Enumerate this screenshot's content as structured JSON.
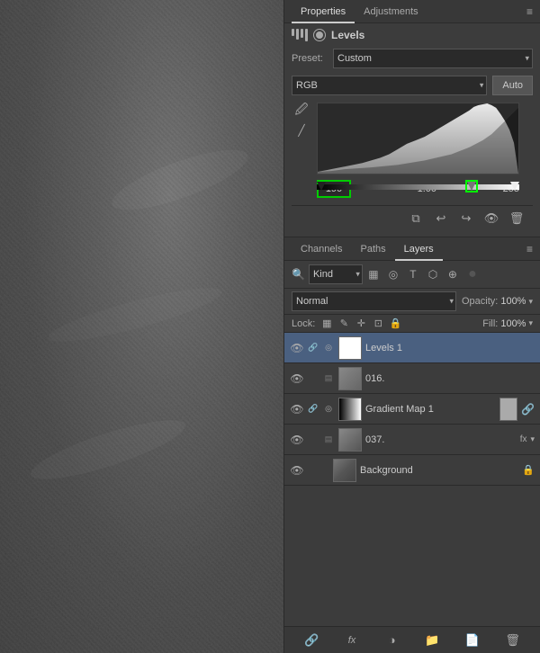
{
  "canvas": {
    "description": "Grayscale sandy texture photo"
  },
  "properties_panel": {
    "tabs": [
      {
        "label": "Properties",
        "active": true
      },
      {
        "label": "Adjustments",
        "active": false
      }
    ],
    "levels": {
      "title": "Levels",
      "preset_label": "Preset:",
      "preset_value": "Custom",
      "channel": "RGB",
      "auto_label": "Auto",
      "input_black": "190",
      "input_mid": "1.00",
      "input_white": "255"
    },
    "toolbar_icons": [
      "clip-icon",
      "rotate-left-icon",
      "rotate-right-icon",
      "eye-icon",
      "trash-icon"
    ]
  },
  "layers_panel": {
    "tabs": [
      {
        "label": "Channels",
        "active": false
      },
      {
        "label": "Paths",
        "active": false
      },
      {
        "label": "Layers",
        "active": true
      }
    ],
    "kind_filter": "Kind",
    "blend_mode": "Normal",
    "opacity_label": "Opacity:",
    "opacity_value": "100%",
    "fill_label": "Fill:",
    "fill_value": "100%",
    "lock_label": "Lock:",
    "layers": [
      {
        "name": "Levels 1",
        "visible": true,
        "has_link": true,
        "has_mask": true,
        "thumb_type": "white-thumb",
        "active": true,
        "has_extra_icon": false,
        "has_lock": false
      },
      {
        "name": "016.",
        "visible": true,
        "has_link": false,
        "has_mask": false,
        "thumb_type": "gray-thumb",
        "active": false,
        "has_extra_icon": false,
        "has_lock": false
      },
      {
        "name": "Gradient Map 1",
        "visible": true,
        "has_link": true,
        "has_mask": true,
        "thumb_type": "gradient-thumb",
        "active": false,
        "has_extra_icon": true,
        "has_lock": false
      },
      {
        "name": "037.",
        "visible": true,
        "has_link": false,
        "has_mask": false,
        "thumb_type": "gray-thumb",
        "active": false,
        "has_extra_icon": true,
        "has_lock": false
      },
      {
        "name": "Background",
        "visible": true,
        "has_link": false,
        "has_mask": false,
        "thumb_type": "photo-thumb",
        "active": false,
        "has_extra_icon": false,
        "has_lock": true
      }
    ],
    "bottom_tools": [
      "link-icon",
      "fx-icon",
      "new-layer-icon",
      "new-group-icon",
      "new-adjustment-icon",
      "delete-icon"
    ]
  }
}
